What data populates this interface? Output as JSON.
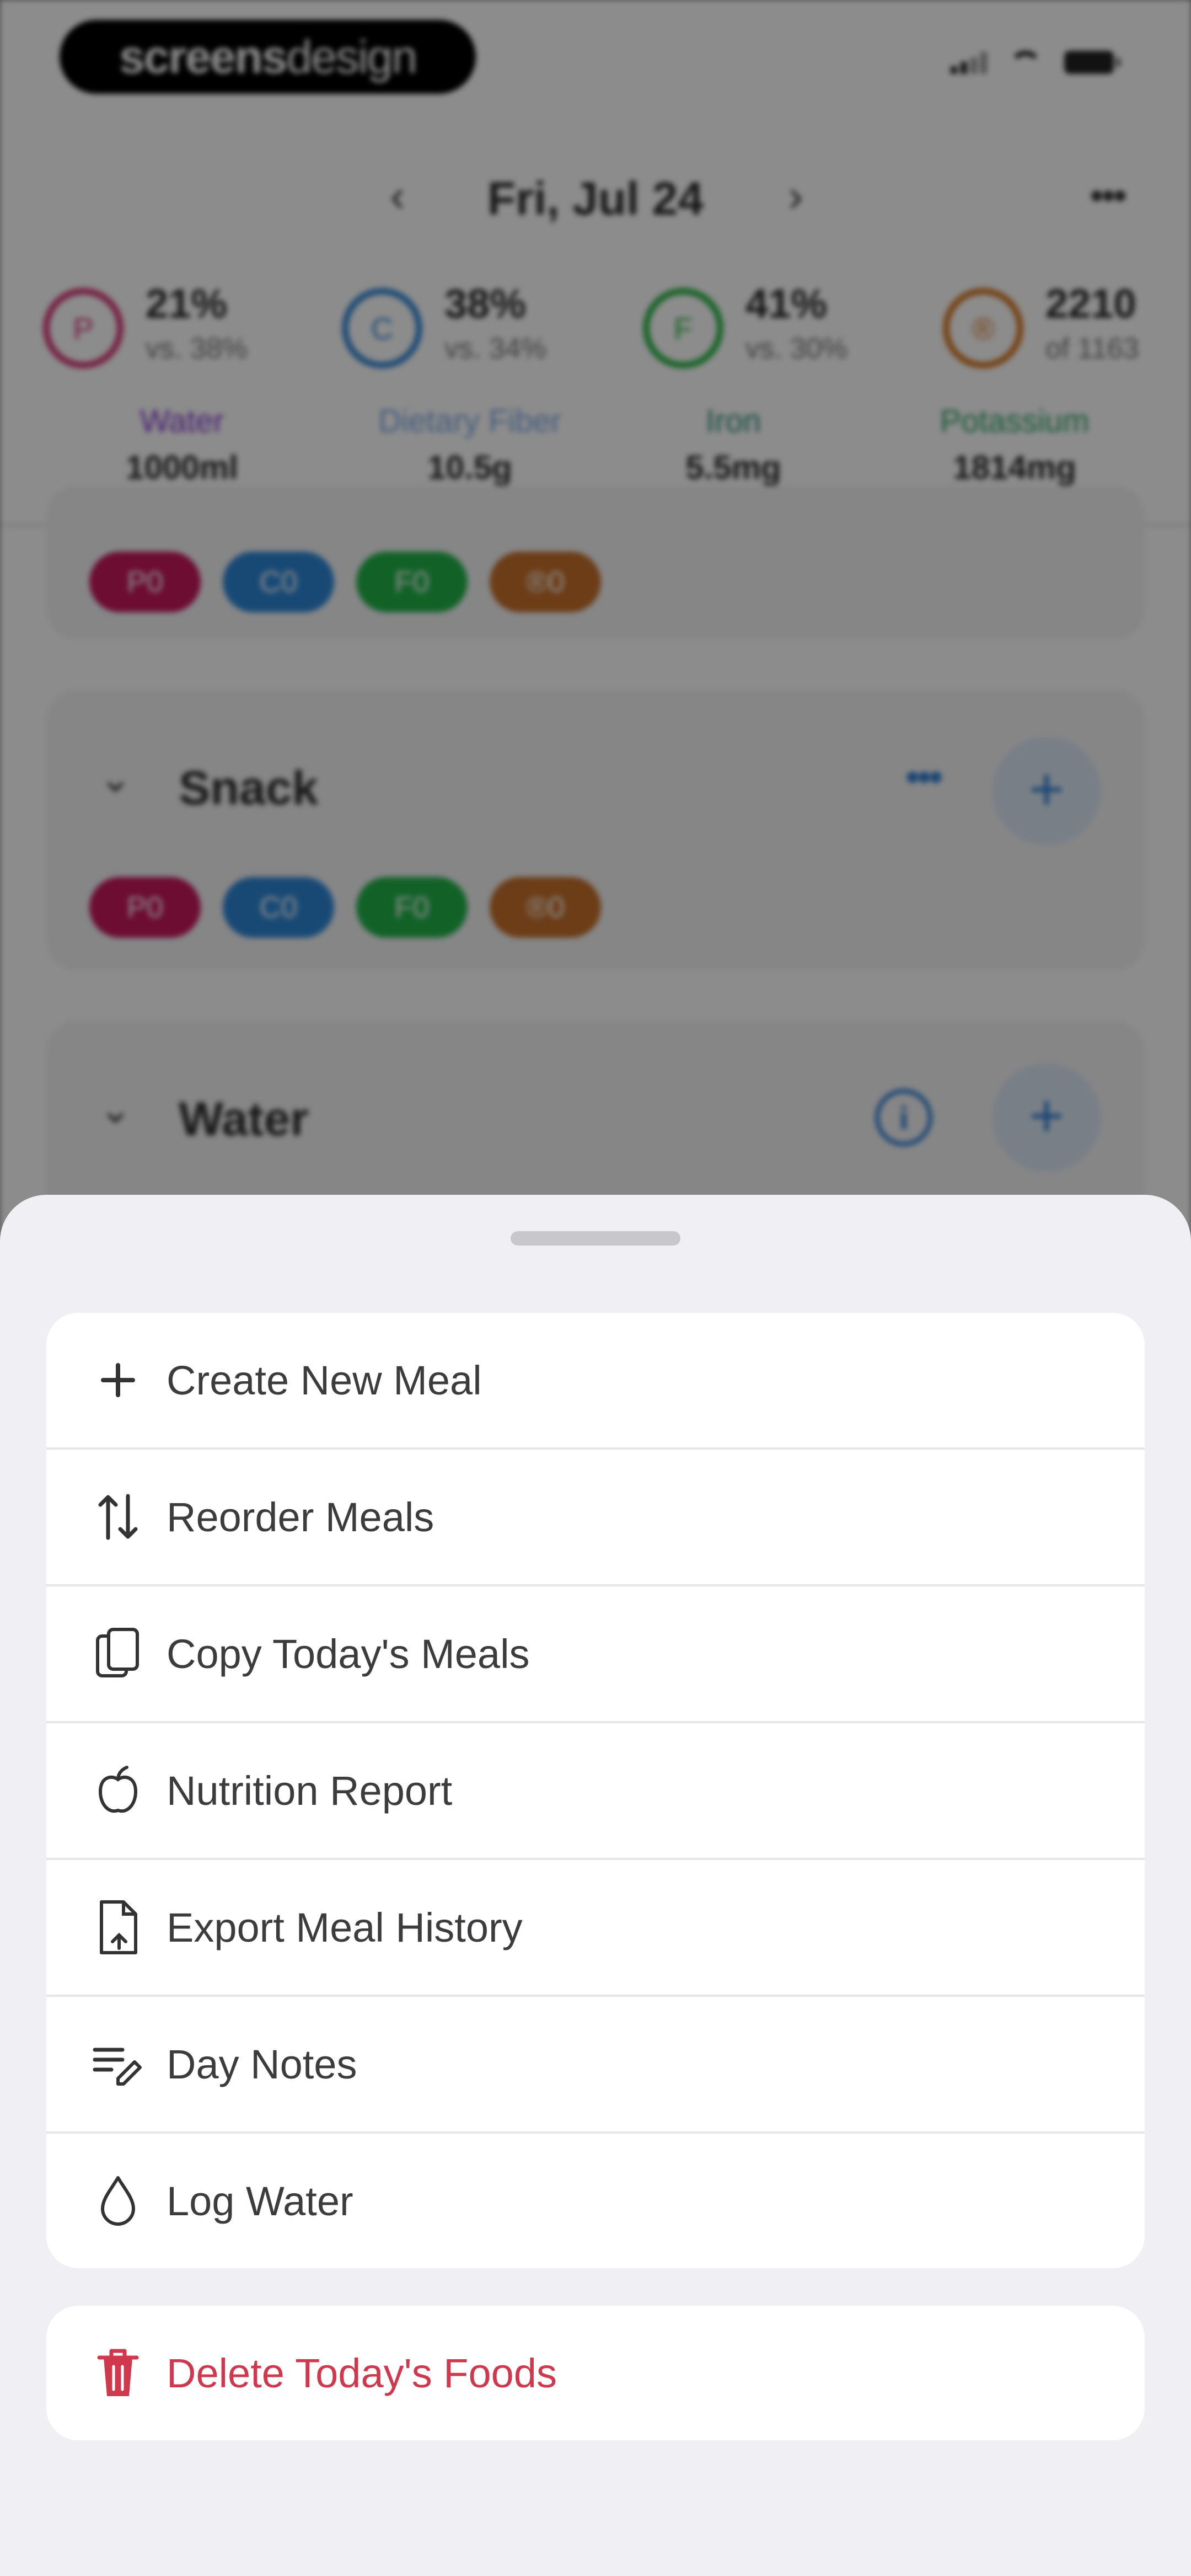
{
  "status_bar": {
    "brand_bold": "screens",
    "brand_light": "design"
  },
  "header": {
    "date": "Fri, Jul 24",
    "prev_icon": "chevron-left",
    "next_icon": "chevron-right",
    "more_icon": "ellipsis"
  },
  "macros": [
    {
      "letter": "P",
      "percent": "21%",
      "sub": "vs. 38%",
      "color": "#d63c78"
    },
    {
      "letter": "C",
      "percent": "38%",
      "sub": "vs. 34%",
      "color": "#3a8ad6"
    },
    {
      "letter": "F",
      "percent": "41%",
      "sub": "vs. 30%",
      "color": "#2fb64a"
    },
    {
      "letter": "®",
      "percent": "2210",
      "sub": "of 1163",
      "color": "#d67a2a"
    }
  ],
  "nutrients": [
    {
      "name": "Water",
      "value": "1000ml",
      "color": "#8a3bd1"
    },
    {
      "name": "Dietary Fiber",
      "value": "10.5g",
      "color": "#7fa9e6"
    },
    {
      "name": "Iron",
      "value": "5.5mg",
      "color": "#2e8f7a"
    },
    {
      "name": "Potassium",
      "value": "1814mg",
      "color": "#2fa46c"
    }
  ],
  "chips": [
    {
      "label": "P0",
      "color": "#c6185a"
    },
    {
      "label": "C0",
      "color": "#2d86d6"
    },
    {
      "label": "F0",
      "color": "#22b34a"
    },
    {
      "label": "®0",
      "color": "#c56f2b"
    }
  ],
  "meals": {
    "snack": {
      "title": "Snack"
    },
    "water": {
      "title": "Water"
    }
  },
  "action_sheet": {
    "items": [
      {
        "label": "Create New Meal",
        "icon": "plus-icon"
      },
      {
        "label": "Reorder Meals",
        "icon": "reorder-arrows-icon"
      },
      {
        "label": "Copy Today's Meals",
        "icon": "copy-icon"
      },
      {
        "label": "Nutrition Report",
        "icon": "apple-report-icon"
      },
      {
        "label": "Export Meal History",
        "icon": "export-document-icon"
      },
      {
        "label": "Day Notes",
        "icon": "notes-pencil-icon"
      },
      {
        "label": "Log Water",
        "icon": "water-drop-icon"
      }
    ],
    "delete": {
      "label": "Delete Today's Foods",
      "icon": "trash-icon",
      "color": "#d0384e"
    }
  }
}
